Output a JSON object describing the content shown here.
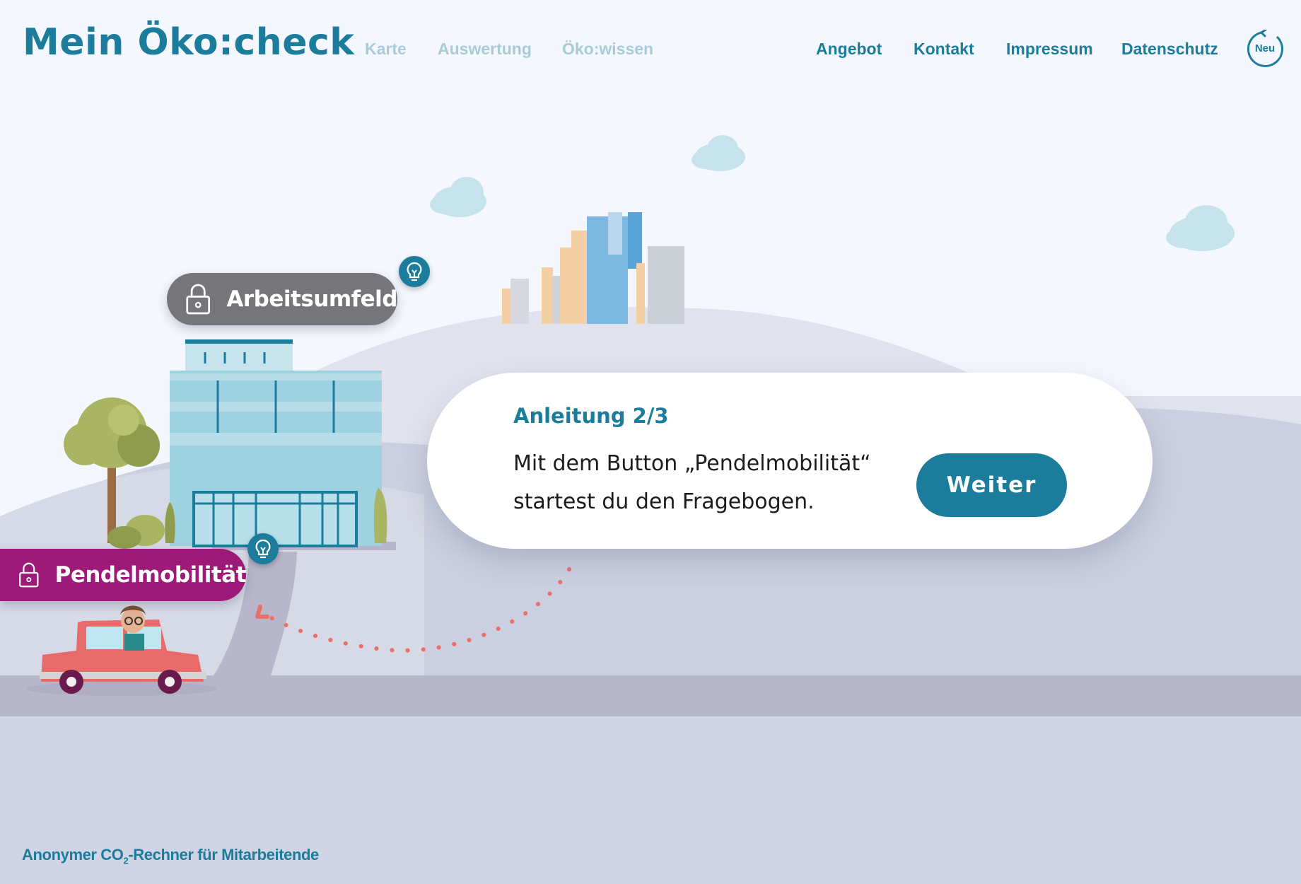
{
  "header": {
    "brand": "Mein Öko:check",
    "nav_disabled": [
      "Karte",
      "Auswertung",
      "Öko:wissen"
    ],
    "nav_links": [
      "Angebot",
      "Kontakt",
      "Impressum",
      "Datenschutz"
    ],
    "reset_label": "Neu"
  },
  "map": {
    "station_work": "Arbeitsumfeld",
    "station_commute": "Pendelmobilität"
  },
  "tutorial": {
    "title": "Anleitung 2/3",
    "line1": "Mit dem Button „Pendelmobilität“",
    "line2": "startest du den Fragebogen.",
    "button": "Weiter"
  },
  "footer": {
    "text_before": "Anonymer CO",
    "subscript": "2",
    "text_after": "-Rechner für Mitarbeitende"
  },
  "colors": {
    "accent": "#1b7c9c",
    "commute_pill": "#9e1a78",
    "locked_pill": "#76767a",
    "background": "#f4f7fd"
  },
  "icons": [
    "lock-icon",
    "lightbulb-icon",
    "refresh-icon"
  ]
}
